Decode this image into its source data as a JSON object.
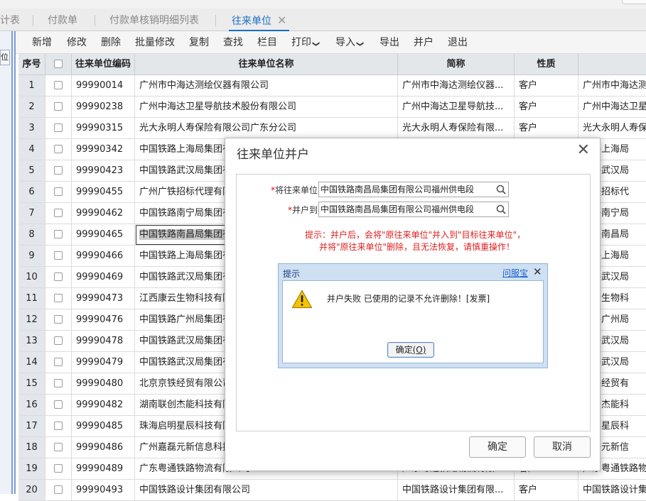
{
  "tabs": [
    {
      "label": "计表",
      "active": false
    },
    {
      "label": "付款单",
      "active": false
    },
    {
      "label": "付款单核销明细列表",
      "active": false
    },
    {
      "label": "往来单位",
      "active": true,
      "close": "✕"
    }
  ],
  "left_strip": {
    "button_label": "位"
  },
  "toolbar": {
    "add": "新增",
    "edit": "修改",
    "delete": "删除",
    "batch_edit": "批量修改",
    "copy": "复制",
    "find": "查找",
    "columns": "栏目",
    "print": "打印",
    "import": "导入",
    "export": "导出",
    "merge": "并户",
    "exit": "退出"
  },
  "grid": {
    "headers": {
      "no": "序号",
      "code": "往来单位编码",
      "name": "往来单位名称",
      "short": "简称",
      "nature": "性质",
      "extra": ""
    },
    "rows": [
      {
        "no": "1",
        "code": "99990014",
        "name": "广州市中海达测绘仪器有限公司",
        "short": "广州市中海达测绘仪器...",
        "nature": "客户",
        "extra": "广州市中海达测"
      },
      {
        "no": "2",
        "code": "99990238",
        "name": "广州中海达卫星导航技术股份有限公司",
        "short": "广州中海达卫星导航技...",
        "nature": "客户",
        "extra": "广州中海达卫星"
      },
      {
        "no": "3",
        "code": "99990315",
        "name": "光大永明人寿保险有限公司广东分公司",
        "short": "光大永明人寿保险有限...",
        "nature": "客户",
        "extra": "光大永明人寿保"
      },
      {
        "no": "4",
        "code": "99990342",
        "name": "中国铁路上海局集团有",
        "short": "",
        "nature": "",
        "extra": "铁路上海局"
      },
      {
        "no": "5",
        "code": "99990423",
        "name": "中国铁路武汉局集团有",
        "short": "",
        "nature": "",
        "extra": "铁路武汉局"
      },
      {
        "no": "6",
        "code": "99990455",
        "name": "广州广铁招标代理有限",
        "short": "",
        "nature": "",
        "extra": "广铁招标代"
      },
      {
        "no": "7",
        "code": "99990462",
        "name": "中国铁路南宁局集团有",
        "short": "",
        "nature": "",
        "extra": "铁路南宁局"
      },
      {
        "no": "8",
        "code": "99990465",
        "name": "中国铁路南昌局集团有",
        "short": "",
        "nature": "",
        "extra": "铁路南昌局"
      },
      {
        "no": "9",
        "code": "99990466",
        "name": "中国铁路上海局集团有",
        "short": "",
        "nature": "",
        "extra": "铁路上海局"
      },
      {
        "no": "10",
        "code": "99990469",
        "name": "中国铁路武汉局集团有",
        "short": "",
        "nature": "",
        "extra": "铁路武汉局"
      },
      {
        "no": "11",
        "code": "99990473",
        "name": "江西康云生物科技有限",
        "short": "",
        "nature": "",
        "extra": "康云生物科"
      },
      {
        "no": "12",
        "code": "99990476",
        "name": "中国铁路广州局集团有",
        "short": "",
        "nature": "",
        "extra": "铁路广州局"
      },
      {
        "no": "13",
        "code": "99990478",
        "name": "中国铁路武汉局集团有",
        "short": "",
        "nature": "",
        "extra": "铁路武汉局"
      },
      {
        "no": "14",
        "code": "99990479",
        "name": "中国铁路武汉局集团有",
        "short": "",
        "nature": "",
        "extra": "铁路武汉局"
      },
      {
        "no": "15",
        "code": "99990480",
        "name": "北京京铁经贸有限公司",
        "short": "",
        "nature": "",
        "extra": "京铁经贸有"
      },
      {
        "no": "16",
        "code": "99990482",
        "name": "湖南联创杰能科技有限",
        "short": "",
        "nature": "",
        "extra": "联创杰能科"
      },
      {
        "no": "17",
        "code": "99990485",
        "name": "珠海启明星辰科技有限",
        "short": "",
        "nature": "",
        "extra": "启明星辰科"
      },
      {
        "no": "18",
        "code": "99990486",
        "name": "广州嘉磊元新信息科技",
        "short": "",
        "nature": "",
        "extra": "嘉磊元新信"
      },
      {
        "no": "19",
        "code": "99990489",
        "name": "广东粤通铁路物流有限公司",
        "short": "广东粤通铁路物流有限...",
        "nature": "客户",
        "extra": "广东粤通铁路物"
      },
      {
        "no": "20",
        "code": "99990493",
        "name": "中国铁路设计集团有限公司",
        "short": "中国铁路设计集团有限...",
        "nature": "客户",
        "extra": "中国铁路设计集"
      }
    ]
  },
  "merge_dialog": {
    "title": "往来单位并户",
    "close": "✕",
    "from_label": "将往来单位",
    "from_value": "中国铁路南昌局集团有限公司福州供电段",
    "to_label": "并户到",
    "to_value": "中国铁路南昌局集团有限公司福州供电段",
    "warn_line1": "提示：并户后，会将\"原往来单位\"并入到\"目标往来单位\"，",
    "warn_line2": "并将\"原往来单位\"删除，且无法恢复，请慎重操作！",
    "ok": "确定",
    "cancel": "取消"
  },
  "alert_dialog": {
    "title": "提示",
    "link": "问服宝",
    "close": "✕",
    "message": "并户失败 已使用的记录不允许删除！[发票]",
    "ok_label": "确定",
    "ok_key": "(O)"
  },
  "colors": {
    "accent": "#1a6fc1",
    "warning": "#e02020",
    "alert_bg": "#cfe0f2"
  }
}
